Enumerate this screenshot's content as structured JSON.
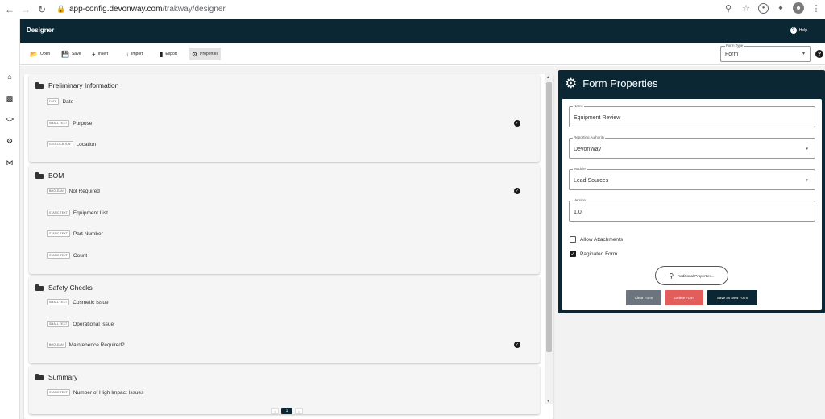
{
  "browser": {
    "url_host": "app-config.devonway.com",
    "url_path": "/trakway/designer",
    "icons": [
      "back-arrow-icon",
      "forward-arrow-icon",
      "reload-icon",
      "lock-icon",
      "zoom-icon",
      "star-icon",
      "extension-icon",
      "puzzle-icon",
      "profile-avatar",
      "more-vert-icon"
    ]
  },
  "header": {
    "title": "Designer",
    "help_label": "Help"
  },
  "toolbar": {
    "open_label": "Open",
    "save_label": "Save",
    "insert_label": "Insert",
    "import_label": "Import",
    "export_label": "Export",
    "properties_label": "Properties",
    "form_type_label": "Form Type",
    "form_type_value": "Form"
  },
  "rail": {
    "icons": [
      "home-icon",
      "chart-icon",
      "code-icon",
      "gear-icon",
      "network-icon"
    ]
  },
  "sections": [
    {
      "title": "Preliminary Information",
      "fields": [
        {
          "type": "DATE",
          "label": "Date",
          "checked": false
        },
        {
          "type": "SMALL TEXT",
          "label": "Purpose",
          "checked": true
        },
        {
          "type": "GEOLOCATION",
          "label": "Location",
          "checked": false
        }
      ]
    },
    {
      "title": "BOM",
      "fields": [
        {
          "type": "BOOLEAN",
          "label": "Not Required",
          "checked": true
        },
        {
          "type": "STATIC TEXT",
          "label": "Equipment List",
          "checked": false
        },
        {
          "type": "STATIC TEXT",
          "label": "Part Number",
          "checked": false
        },
        {
          "type": "STATIC TEXT",
          "label": "Count",
          "checked": false
        }
      ]
    },
    {
      "title": "Safety Checks",
      "fields": [
        {
          "type": "SMALL TEXT",
          "label": "Cosmetic Issue",
          "checked": false
        },
        {
          "type": "SMALL TEXT",
          "label": "Operational Issue",
          "checked": false
        },
        {
          "type": "BOOLEAN",
          "label": "Maintenence Required?",
          "checked": true
        }
      ]
    },
    {
      "title": "Summary",
      "fields": [
        {
          "type": "STATIC TEXT",
          "label": "Number of High Impact Issues",
          "checked": false
        }
      ]
    }
  ],
  "pager": {
    "current_page": "1",
    "prev": "‹",
    "next": "›"
  },
  "properties": {
    "title": "Form Properties",
    "name_label": "Name",
    "name_value": "Equipment Review",
    "authority_label": "Reporting Authority",
    "authority_value": "DevonWay",
    "module_label": "Module",
    "module_value": "Lead Sources",
    "version_label": "Version",
    "version_value": "1.0",
    "allow_attachments_label": "Allow Attachments",
    "allow_attachments_checked": false,
    "paginated_label": "Paginated Form",
    "paginated_checked": true,
    "additional_label": "Additional Properties...",
    "clear_label": "Clear Form",
    "delete_label": "Delete Form",
    "save_as_label": "Save as New Form"
  },
  "colors": {
    "header_bg": "#0b2734",
    "delete_btn": "#e35d5b",
    "clear_btn": "#6c757d"
  }
}
